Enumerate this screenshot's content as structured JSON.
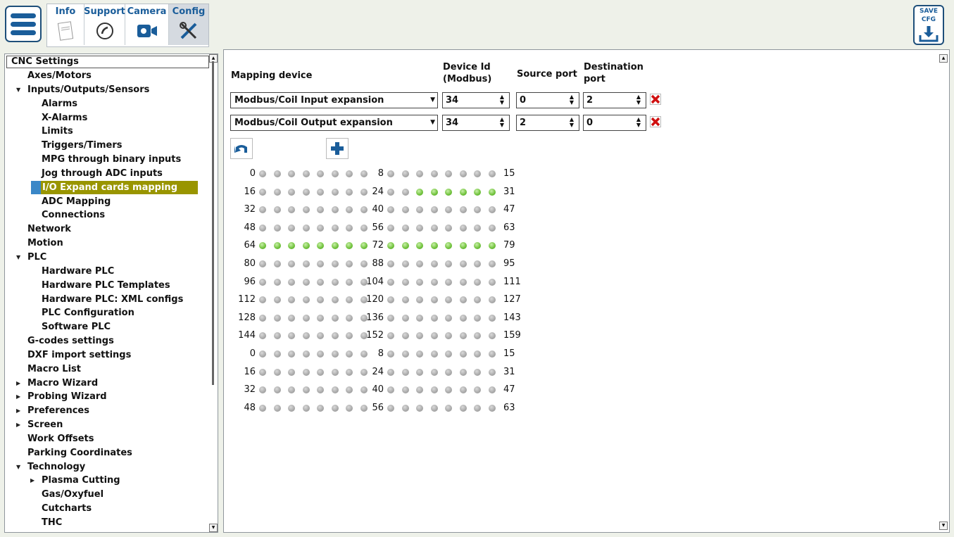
{
  "toolbar": {
    "tabs": [
      {
        "label": "Info",
        "icon": "info-card-icon"
      },
      {
        "label": "Support",
        "icon": "phone-icon"
      },
      {
        "label": "Camera",
        "icon": "camera-icon"
      },
      {
        "label": "Config",
        "icon": "tools-icon"
      }
    ],
    "active_tab": "Config",
    "save": {
      "line1": "SAVE",
      "line2": "CFG"
    }
  },
  "tree": {
    "header": "CNC Settings",
    "items": [
      {
        "label": "Axes/Motors",
        "level": 1,
        "arrow": ""
      },
      {
        "label": "Inputs/Outputs/Sensors",
        "level": 1,
        "arrow": "expanded"
      },
      {
        "label": "Alarms",
        "level": 2,
        "arrow": ""
      },
      {
        "label": "X-Alarms",
        "level": 2,
        "arrow": ""
      },
      {
        "label": "Limits",
        "level": 2,
        "arrow": ""
      },
      {
        "label": "Triggers/Timers",
        "level": 2,
        "arrow": ""
      },
      {
        "label": "MPG through binary inputs",
        "level": 2,
        "arrow": ""
      },
      {
        "label": "Jog through ADC inputs",
        "level": 2,
        "arrow": ""
      },
      {
        "label": "I/O Expand cards mapping",
        "level": 2,
        "arrow": "",
        "selected": true
      },
      {
        "label": "ADC Mapping",
        "level": 2,
        "arrow": ""
      },
      {
        "label": "Connections",
        "level": 2,
        "arrow": ""
      },
      {
        "label": "Network",
        "level": 1,
        "arrow": ""
      },
      {
        "label": "Motion",
        "level": 1,
        "arrow": ""
      },
      {
        "label": "PLC",
        "level": 1,
        "arrow": "expanded"
      },
      {
        "label": "Hardware PLC",
        "level": 2,
        "arrow": ""
      },
      {
        "label": "Hardware PLC Templates",
        "level": 2,
        "arrow": ""
      },
      {
        "label": "Hardware PLC: XML configs",
        "level": 2,
        "arrow": ""
      },
      {
        "label": "PLC Configuration",
        "level": 2,
        "arrow": ""
      },
      {
        "label": "Software PLC",
        "level": 2,
        "arrow": ""
      },
      {
        "label": "G-codes settings",
        "level": 1,
        "arrow": ""
      },
      {
        "label": "DXF import settings",
        "level": 1,
        "arrow": ""
      },
      {
        "label": "Macro List",
        "level": 1,
        "arrow": ""
      },
      {
        "label": "Macro Wizard",
        "level": 1,
        "arrow": "collapsed"
      },
      {
        "label": "Probing Wizard",
        "level": 1,
        "arrow": "collapsed"
      },
      {
        "label": "Preferences",
        "level": 1,
        "arrow": "collapsed"
      },
      {
        "label": "Screen",
        "level": 1,
        "arrow": "collapsed"
      },
      {
        "label": "Work Offsets",
        "level": 1,
        "arrow": ""
      },
      {
        "label": "Parking Coordinates",
        "level": 1,
        "arrow": ""
      },
      {
        "label": "Technology",
        "level": 1,
        "arrow": "expanded"
      },
      {
        "label": "Plasma Cutting",
        "level": 2,
        "arrow": "collapsed"
      },
      {
        "label": "Gas/Oxyfuel",
        "level": 2,
        "arrow": ""
      },
      {
        "label": "Cutcharts",
        "level": 2,
        "arrow": ""
      },
      {
        "label": "THC",
        "level": 2,
        "arrow": ""
      }
    ]
  },
  "mapping": {
    "headers": {
      "device": "Mapping device",
      "device_id_1": "Device Id",
      "device_id_2": "(Modbus)",
      "source_port": "Source port",
      "dest_port_1": "Destination",
      "dest_port_2": "port"
    },
    "rows": [
      {
        "device": "Modbus/Coil Input expansion",
        "device_id": "34",
        "source_port": "0",
        "dest_port": "2"
      },
      {
        "device": "Modbus/Coil Output expansion",
        "device_id": "34",
        "source_port": "2",
        "dest_port": "0"
      }
    ]
  },
  "io_grid": {
    "rows": [
      {
        "left_start": "0",
        "mid_start": "8",
        "end": "15",
        "left_on": [
          0,
          0,
          0,
          0,
          0,
          0,
          0,
          0
        ],
        "right_on": [
          0,
          0,
          0,
          0,
          0,
          0,
          0,
          0
        ]
      },
      {
        "left_start": "16",
        "mid_start": "24",
        "end": "31",
        "left_on": [
          0,
          0,
          0,
          0,
          0,
          0,
          0,
          0
        ],
        "right_on": [
          0,
          0,
          1,
          1,
          1,
          1,
          1,
          1
        ]
      },
      {
        "left_start": "32",
        "mid_start": "40",
        "end": "47",
        "left_on": [
          0,
          0,
          0,
          0,
          0,
          0,
          0,
          0
        ],
        "right_on": [
          0,
          0,
          0,
          0,
          0,
          0,
          0,
          0
        ]
      },
      {
        "left_start": "48",
        "mid_start": "56",
        "end": "63",
        "left_on": [
          0,
          0,
          0,
          0,
          0,
          0,
          0,
          0
        ],
        "right_on": [
          0,
          0,
          0,
          0,
          0,
          0,
          0,
          0
        ]
      },
      {
        "left_start": "64",
        "mid_start": "72",
        "end": "79",
        "left_on": [
          1,
          1,
          1,
          1,
          1,
          1,
          1,
          1
        ],
        "right_on": [
          1,
          1,
          1,
          1,
          1,
          1,
          1,
          1
        ]
      },
      {
        "left_start": "80",
        "mid_start": "88",
        "end": "95",
        "left_on": [
          0,
          0,
          0,
          0,
          0,
          0,
          0,
          0
        ],
        "right_on": [
          0,
          0,
          0,
          0,
          0,
          0,
          0,
          0
        ]
      },
      {
        "left_start": "96",
        "mid_start": "104",
        "end": "111",
        "left_on": [
          0,
          0,
          0,
          0,
          0,
          0,
          0,
          0
        ],
        "right_on": [
          0,
          0,
          0,
          0,
          0,
          0,
          0,
          0
        ]
      },
      {
        "left_start": "112",
        "mid_start": "120",
        "end": "127",
        "left_on": [
          0,
          0,
          0,
          0,
          0,
          0,
          0,
          0
        ],
        "right_on": [
          0,
          0,
          0,
          0,
          0,
          0,
          0,
          0
        ]
      },
      {
        "left_start": "128",
        "mid_start": "136",
        "end": "143",
        "left_on": [
          0,
          0,
          0,
          0,
          0,
          0,
          0,
          0
        ],
        "right_on": [
          0,
          0,
          0,
          0,
          0,
          0,
          0,
          0
        ]
      },
      {
        "left_start": "144",
        "mid_start": "152",
        "end": "159",
        "left_on": [
          0,
          0,
          0,
          0,
          0,
          0,
          0,
          0
        ],
        "right_on": [
          0,
          0,
          0,
          0,
          0,
          0,
          0,
          0
        ]
      },
      {
        "left_start": "0",
        "mid_start": "8",
        "end": "15",
        "left_on": [
          0,
          0,
          0,
          0,
          0,
          0,
          0,
          0
        ],
        "right_on": [
          0,
          0,
          0,
          0,
          0,
          0,
          0,
          0
        ]
      },
      {
        "left_start": "16",
        "mid_start": "24",
        "end": "31",
        "left_on": [
          0,
          0,
          0,
          0,
          0,
          0,
          0,
          0
        ],
        "right_on": [
          0,
          0,
          0,
          0,
          0,
          0,
          0,
          0
        ]
      },
      {
        "left_start": "32",
        "mid_start": "40",
        "end": "47",
        "left_on": [
          0,
          0,
          0,
          0,
          0,
          0,
          0,
          0
        ],
        "right_on": [
          0,
          0,
          0,
          0,
          0,
          0,
          0,
          0
        ]
      },
      {
        "left_start": "48",
        "mid_start": "56",
        "end": "63",
        "left_on": [
          0,
          0,
          0,
          0,
          0,
          0,
          0,
          0
        ],
        "right_on": [
          0,
          0,
          0,
          0,
          0,
          0,
          0,
          0
        ]
      }
    ]
  },
  "colors": {
    "accent": "#1a5d9a",
    "selected_bg": "#999500",
    "selected_mark": "#3a87c7",
    "led_on": "#6fc13a",
    "led_off": "#a9a9a9",
    "delete": "#d01010"
  }
}
